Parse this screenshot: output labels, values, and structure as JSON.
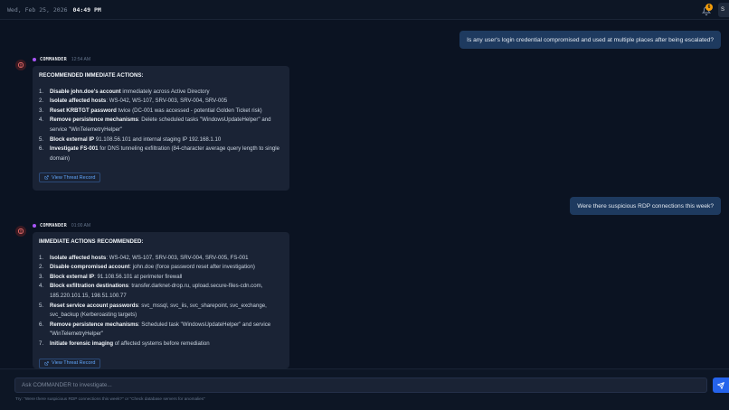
{
  "header": {
    "date": "Wed, Feb 25, 2026",
    "time": "04:49 PM",
    "notification_count": "6",
    "user_initial": "S"
  },
  "colors": {
    "accent": "#2563eb",
    "badge": "#f59e0b",
    "commander_dot": "#a855f7",
    "link": "#60a5fa"
  },
  "messages": {
    "user1": "Is any user's login credential compromised and used at multiple places after being escalated?",
    "cmd1": {
      "sender": "COMMANDER",
      "time": "12:54 AM",
      "heading": "RECOMMENDED IMMEDIATE ACTIONS:",
      "items": [
        {
          "num": "1.",
          "bold": "Disable john.doe's account",
          "rest": " immediately across Active Directory"
        },
        {
          "num": "2.",
          "bold": "Isolate affected hosts",
          "rest": ": WS-042, WS-107, SRV-003, SRV-004, SRV-005"
        },
        {
          "num": "3.",
          "bold": "Reset KRBTGT password",
          "rest": " twice (DC-001 was accessed - potential Golden Ticket risk)"
        },
        {
          "num": "4.",
          "bold": "Remove persistence mechanisms",
          "rest": ": Delete scheduled tasks \"WindowsUpdateHelper\" and service \"WinTelemetryHelper\""
        },
        {
          "num": "5.",
          "bold": "Block external IP",
          "rest": " 91.108.56.101 and internal staging IP 192.168.1.10"
        },
        {
          "num": "6.",
          "bold": "Investigate FS-001",
          "rest": " for DNS tunneling exfiltration (84-character average query length to single domain)"
        }
      ],
      "button": "View Threat Record"
    },
    "user2": "Were there suspicious RDP connections this week?",
    "cmd2": {
      "sender": "COMMANDER",
      "time": "01:00 AM",
      "heading": "IMMEDIATE ACTIONS RECOMMENDED:",
      "items": [
        {
          "num": "1.",
          "bold": "Isolate affected hosts",
          "rest": ": WS-042, WS-107, SRV-003, SRV-004, SRV-005, FS-001"
        },
        {
          "num": "2.",
          "bold": "Disable compromised account",
          "rest": ": john.doe (force password reset after investigation)"
        },
        {
          "num": "3.",
          "bold": "Block external IP",
          "rest": ": 91.108.56.101 at perimeter firewall"
        },
        {
          "num": "4.",
          "bold": "Block exfiltration destinations",
          "rest": ": transfer.darknet-drop.ru, upload.secure-files-cdn.com, 185.220.101.15, 198.51.100.77"
        },
        {
          "num": "5.",
          "bold": "Reset service account passwords",
          "rest": ": svc_mssql, svc_iis, svc_sharepoint, svc_exchange, svc_backup (Kerberoasting targets)"
        },
        {
          "num": "6.",
          "bold": "Remove persistence mechanisms",
          "rest": ": Scheduled task \"WindowsUpdateHelper\" and service \"WinTelemetryHelper\""
        },
        {
          "num": "7.",
          "bold": "Initiate forensic imaging",
          "rest": " of affected systems before remediation"
        }
      ],
      "button": "View Threat Record"
    }
  },
  "composer": {
    "placeholder": "Ask COMMANDER to investigate...",
    "hint": "Try: \"Were there suspicious RDP connections this week?\" or \"Check database servers for anomalies\""
  }
}
